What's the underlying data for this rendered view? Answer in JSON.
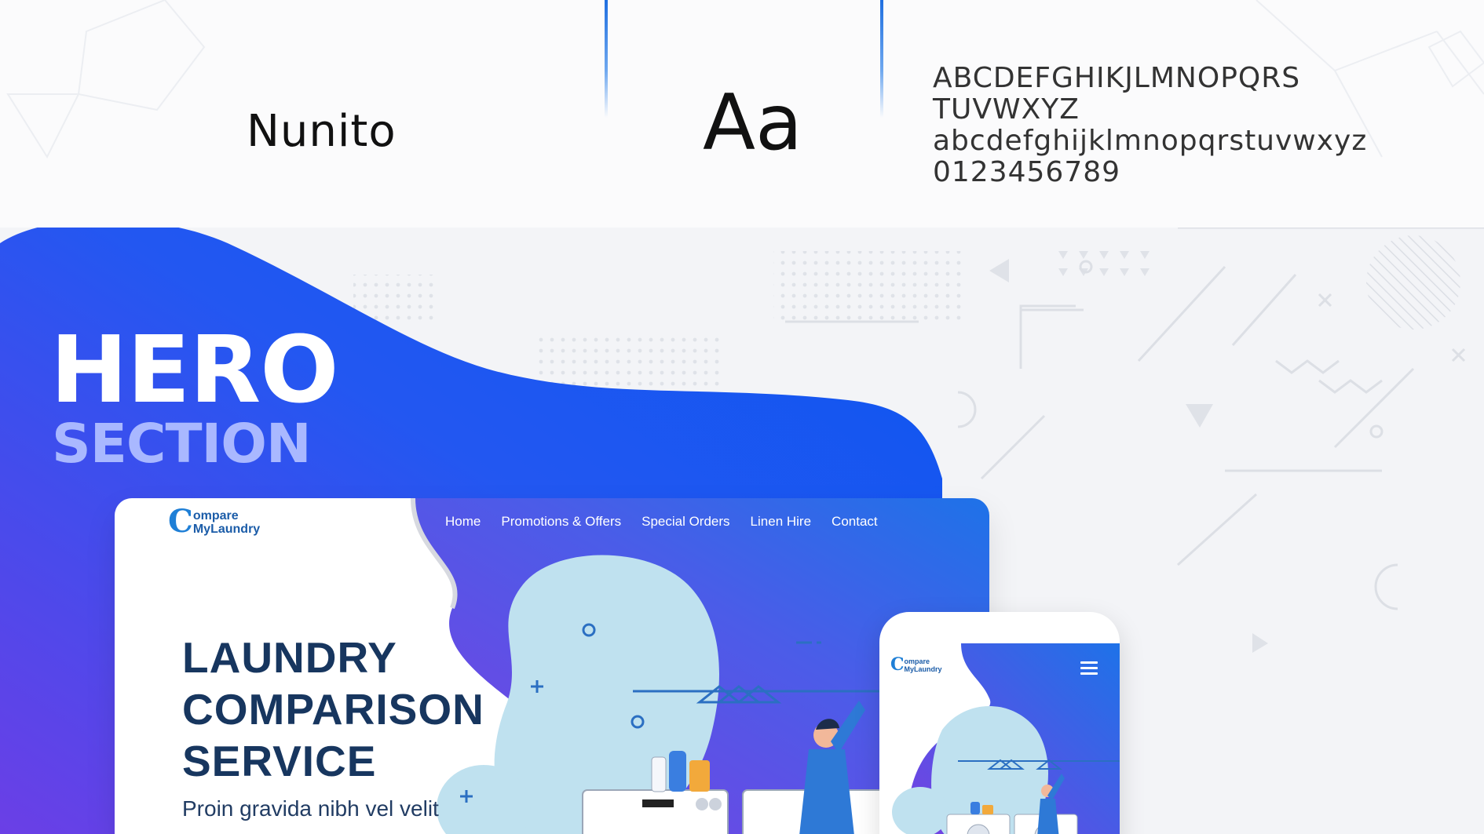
{
  "typography": {
    "font_name": "Nunito",
    "sample": "Aa",
    "uppercase_line1": "ABCDEFGHIKJLMNOPQRS",
    "uppercase_line2": "TUVWXYZ",
    "lowercase": "abcdefghijklmnopqrstuvwxyz",
    "digits": "0123456789",
    "accent_color": "#1f6fe0"
  },
  "hero_label": {
    "title": "HERO",
    "subtitle": "SECTION"
  },
  "colors": {
    "blob_start": "#6b3fe6",
    "blob_end": "#0a56f0",
    "brand_blue": "#1f7fd6",
    "heading_navy": "#17365f",
    "background_gray": "#f3f4f7"
  },
  "website": {
    "logo": {
      "mark": "C",
      "line1": "ompare",
      "line2": "MyLaundry"
    },
    "nav": [
      "Home",
      "Promotions & Offers",
      "Special Orders",
      "Linen Hire",
      "Contact"
    ],
    "headline": [
      "LAUNDRY",
      "COMPARISON",
      "SERVICE"
    ],
    "lede": "Proin gravida nibh vel velit"
  },
  "mobile": {
    "logo": {
      "mark": "C",
      "line1": "ompare",
      "line2": "MyLaundry"
    },
    "menu_icon": "hamburger-icon"
  }
}
